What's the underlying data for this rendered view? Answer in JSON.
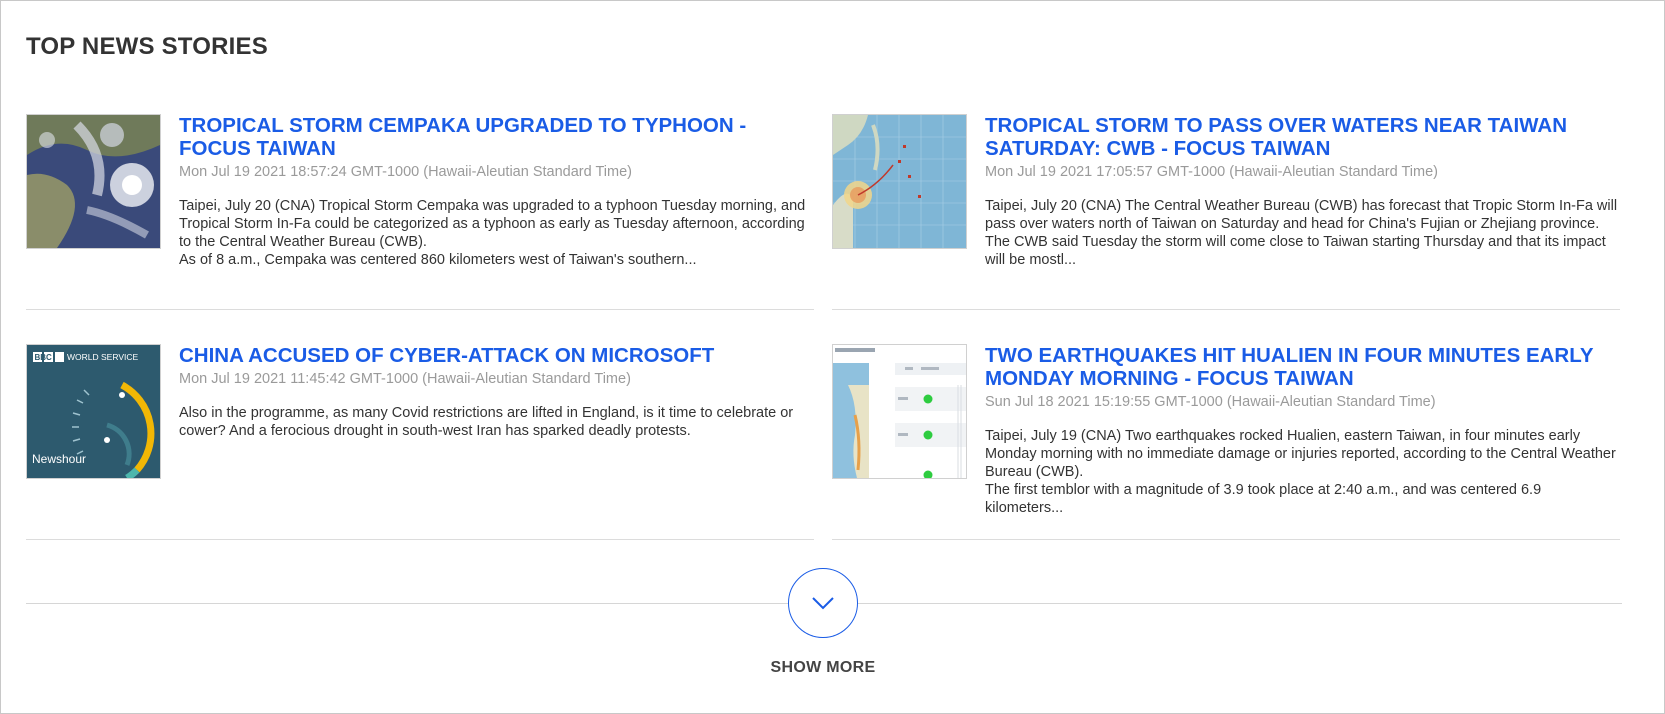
{
  "section": {
    "title": "TOP NEWS STORIES"
  },
  "stories": [
    {
      "title": "TROPICAL STORM CEMPAKA UPGRADED TO TYPHOON - FOCUS TAIWAN",
      "date": "Mon Jul 19 2021 18:57:24 GMT-1000 (Hawaii-Aleutian Standard Time)",
      "summary": "Taipei, July 20 (CNA) Tropical Storm Cempaka was upgraded to a typhoon Tuesday morning, and Tropical Storm In-Fa could be categorized as a typhoon as early as Tuesday afternoon, according to the Central Weather Bureau (CWB).\nAs of 8 a.m., Cempaka was centered 860 kilometers west of Taiwan's southern...",
      "thumb": "satellite-image"
    },
    {
      "title": "TROPICAL STORM TO PASS OVER WATERS NEAR TAIWAN SATURDAY: CWB - FOCUS TAIWAN",
      "date": "Mon Jul 19 2021 17:05:57 GMT-1000 (Hawaii-Aleutian Standard Time)",
      "summary": "Taipei, July 20 (CNA) The Central Weather Bureau (CWB) has forecast that Tropic Storm In-Fa will pass over waters north of Taiwan on Saturday and head for China's Fujian or Zhejiang province.\nThe CWB said Tuesday the storm will come close to Taiwan starting Thursday and that its impact will be mostl...",
      "thumb": "storm-track-map"
    },
    {
      "title": "CHINA ACCUSED OF CYBER-ATTACK ON MICROSOFT",
      "date": "Mon Jul 19 2021 11:45:42 GMT-1000 (Hawaii-Aleutian Standard Time)",
      "summary": "Also in the programme, as many Covid restrictions are lifted in England, is it time to celebrate or cower? And a ferocious drought in south-west Iran has sparked deadly protests.",
      "thumb": "bbc-newshour-logo",
      "thumb_text": {
        "brand": "BBC",
        "service": "WORLD SERVICE",
        "show": "Newshour"
      }
    },
    {
      "title": "TWO EARTHQUAKES HIT HUALIEN IN FOUR MINUTES EARLY MONDAY MORNING - FOCUS TAIWAN",
      "date": "Sun Jul 18 2021 15:19:55 GMT-1000 (Hawaii-Aleutian Standard Time)",
      "summary": "Taipei, July 19 (CNA) Two earthquakes rocked Hualien, eastern Taiwan, in four minutes early Monday morning with no immediate damage or injuries reported, according to the Central Weather Bureau (CWB).\nThe first temblor with a magnitude of 3.9 took place at 2:40 a.m., and was centered 6.9 kilometers...",
      "thumb": "earthquake-report-map"
    }
  ],
  "more": {
    "label": "SHOW MORE",
    "icon": "chevron-down-icon"
  },
  "colors": {
    "link": "#1a5ce6",
    "date": "#9a9a9a",
    "divider": "#dcdcdc"
  }
}
